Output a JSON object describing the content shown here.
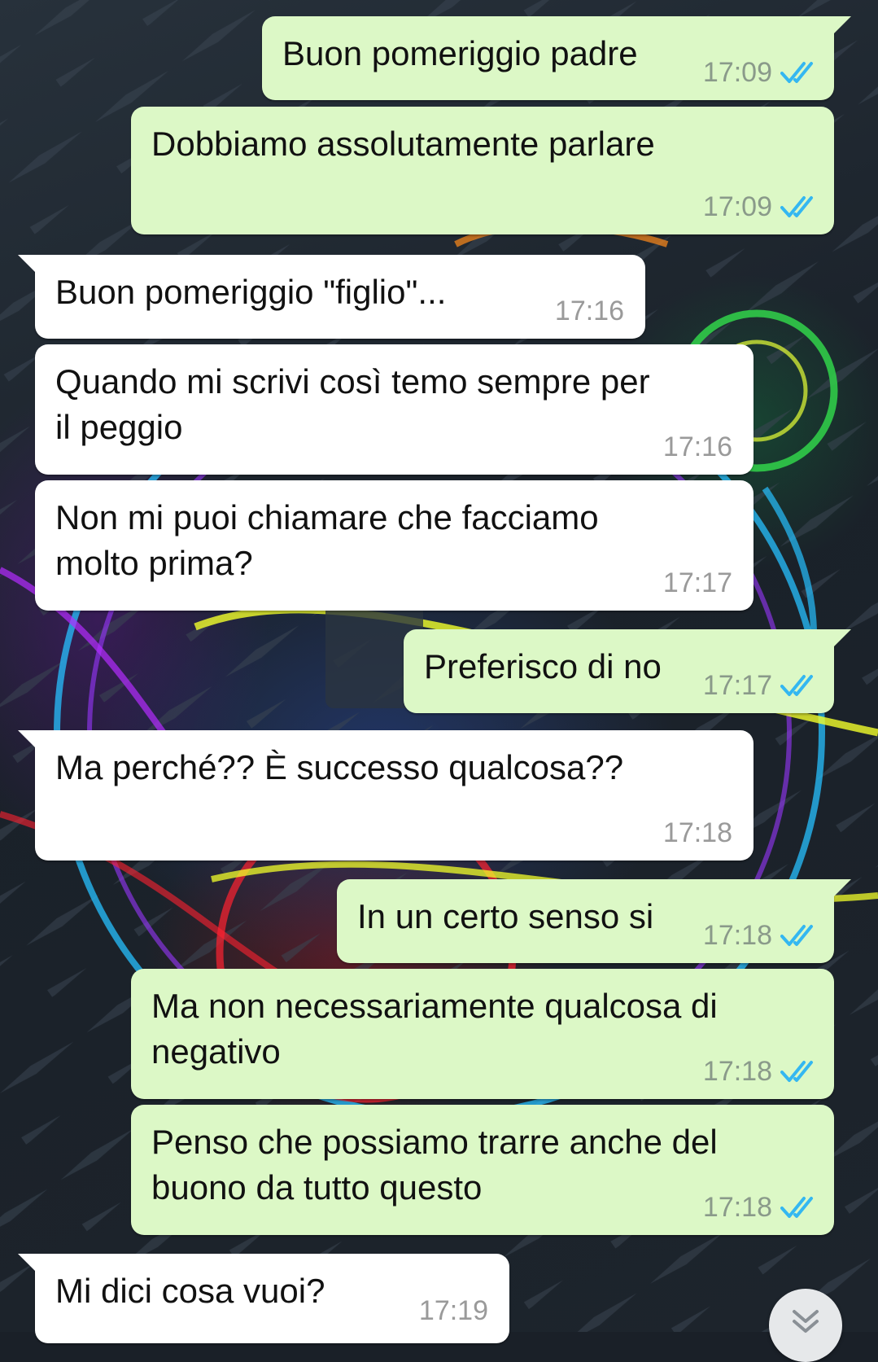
{
  "colors": {
    "outgoing_bubble": "#dcf8c6",
    "incoming_bubble": "#ffffff",
    "read_ticks": "#34b7f1"
  },
  "messages": [
    {
      "direction": "out",
      "text": "Buon pomeriggio padre",
      "time": "17:09",
      "status": "read-icon"
    },
    {
      "direction": "out",
      "text": "Dobbiamo assolutamente parlare",
      "time": "17:09",
      "status": "read-icon"
    },
    {
      "direction": "in",
      "text": "Buon pomeriggio \"figlio\"...",
      "time": "17:16"
    },
    {
      "direction": "in",
      "text": "Quando mi scrivi così temo sempre per\nil peggio",
      "time": "17:16"
    },
    {
      "direction": "in",
      "text": "Non mi puoi chiamare che facciamo\nmolto prima?",
      "time": "17:17"
    },
    {
      "direction": "out",
      "text": "Preferisco di no",
      "time": "17:17",
      "status": "read-icon"
    },
    {
      "direction": "in",
      "text": "Ma perché?? È successo qualcosa??",
      "time": "17:18"
    },
    {
      "direction": "out",
      "text": "In un certo senso si",
      "time": "17:18",
      "status": "read-icon"
    },
    {
      "direction": "out",
      "text": "Ma non necessariamente qualcosa di\nnegativo",
      "time": "17:18",
      "status": "read-icon"
    },
    {
      "direction": "out",
      "text": "Penso che possiamo trarre anche del\nbuono da tutto questo",
      "time": "17:18",
      "status": "read-icon"
    },
    {
      "direction": "in",
      "text": "Mi dici cosa vuoi?",
      "time": "17:19"
    }
  ],
  "scroll_button": {
    "icon": "double-chevron-down-icon"
  }
}
